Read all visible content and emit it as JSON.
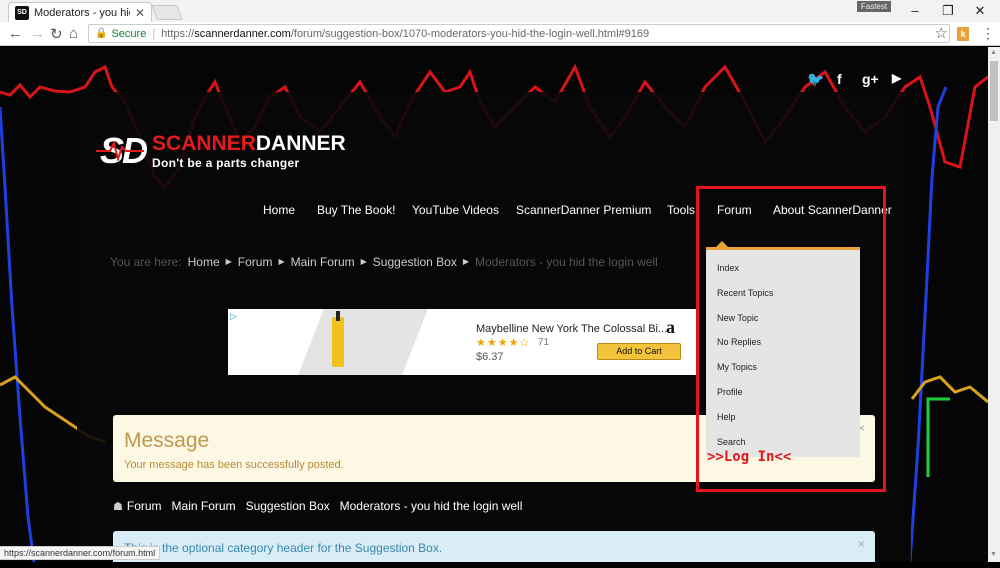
{
  "browser": {
    "tab_title": "Moderators - you hid th",
    "tab_favicon": "SD",
    "top_badge": "Fastest",
    "url_scheme": "https://",
    "url_host": "scannerdanner.com",
    "url_path": "/forum/suggestion-box/1070-moderators-you-hid-the-login-well.html#9169",
    "secure_label": "Secure",
    "extension_label": "k",
    "status_url": "https://scannerdanner.com/forum.html"
  },
  "social": [
    {
      "name": "twitter-icon",
      "glyph": "🐦"
    },
    {
      "name": "facebook-icon",
      "glyph": "f"
    },
    {
      "name": "google-plus-icon",
      "glyph": "g+"
    },
    {
      "name": "youtube-icon",
      "glyph": "▶"
    }
  ],
  "logo": {
    "mark": "SD",
    "name_part1": "SCANNER",
    "name_part2": "DANNER",
    "tagline": "Don't be a parts changer"
  },
  "nav": [
    "Home",
    "Buy The Book!",
    "YouTube Videos",
    "ScannerDanner Premium",
    "Tools",
    "Forum",
    "About ScannerDanner"
  ],
  "breadcrumb": {
    "prefix": "You are here:",
    "items": [
      "Home",
      "Forum",
      "Main Forum",
      "Suggestion Box"
    ],
    "current": "Moderators - you hid the login well"
  },
  "ad": {
    "title": "Maybelline New York The Colossal Bi...",
    "stars": "★★★★☆",
    "rating_count": "71",
    "price": "$6.37",
    "button": "Add to Cart",
    "brand": "a"
  },
  "message": {
    "title": "Message",
    "text": "Your message has been successfully posted.",
    "close": "×"
  },
  "forum_crumb": [
    "Forum",
    "Main Forum",
    "Suggestion Box",
    "Moderators - you hid the login well"
  ],
  "info": {
    "text": "This is the optional category header for the Suggestion Box.",
    "close": "×"
  },
  "dropdown": [
    "Index",
    "Recent Topics",
    "New Topic",
    "No Replies",
    "My Topics",
    "Profile",
    "Help",
    "Search"
  ],
  "annotation": ">>Log In<<",
  "colors": {
    "accent_orange": "#e7a33a",
    "annotation_red": "#e4161b",
    "logo_red": "#e21c1c",
    "message_bg": "#fcf8e3",
    "info_bg": "#d9edf7"
  }
}
